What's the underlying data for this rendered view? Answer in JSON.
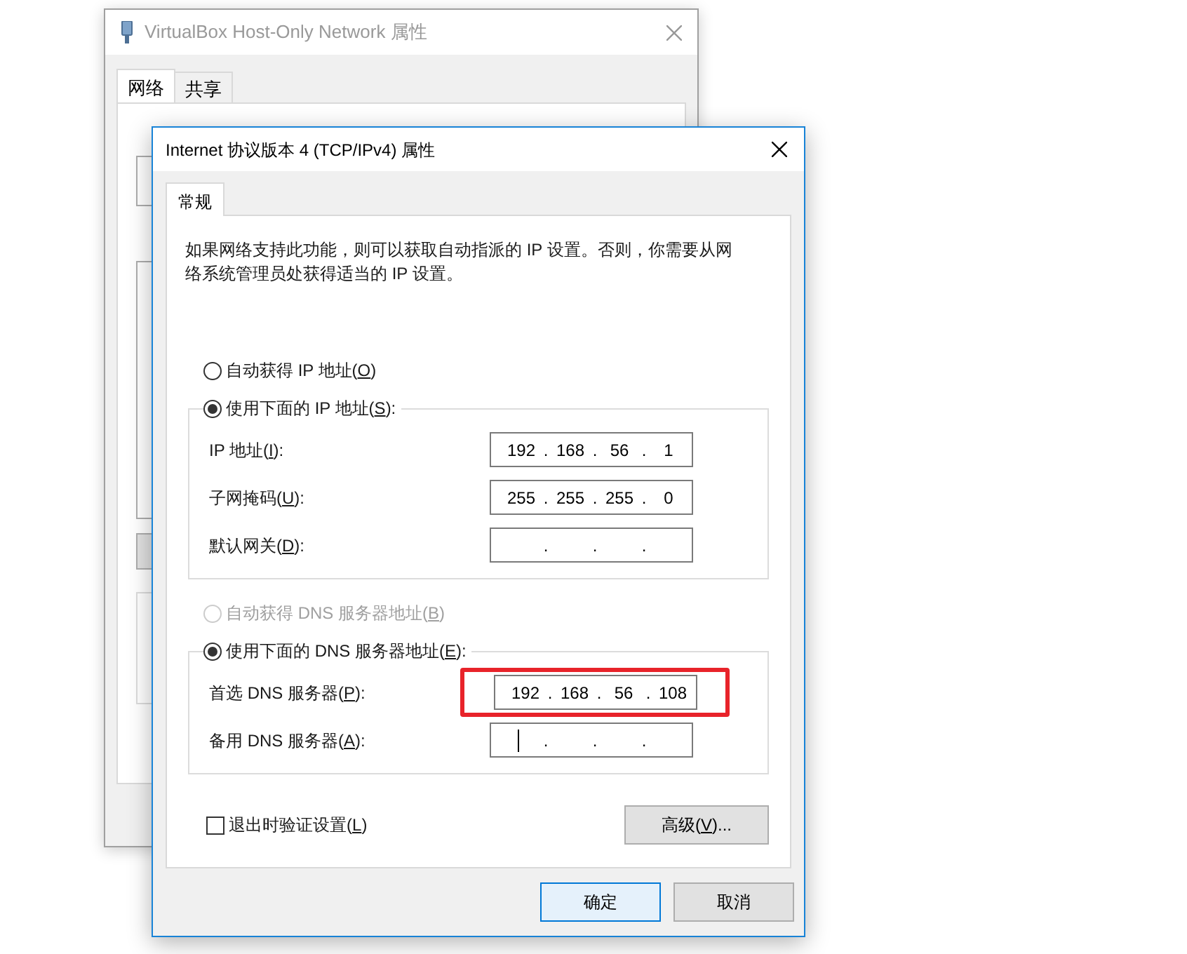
{
  "back_window": {
    "title": "VirtualBox Host-Only Network 属性",
    "tabs": [
      {
        "label": "网络",
        "selected": true
      },
      {
        "label": "共享",
        "selected": false
      }
    ]
  },
  "dialog": {
    "title": "Internet 协议版本 4 (TCP/IPv4) 属性",
    "tabs": [
      {
        "label": "常规",
        "selected": true
      }
    ],
    "description": "如果网络支持此功能，则可以获取自动指派的 IP 设置。否则，你需要从网络系统管理员处获得适当的 IP 设置。",
    "separator": ".",
    "ip_groups": [
      {
        "auto": {
          "label": "自动获得 IP 地址(O)",
          "selected": false,
          "disabled": false
        },
        "manual": {
          "label": "使用下面的 IP 地址(S):",
          "selected": true,
          "disabled": false
        },
        "fields": [
          {
            "label": "IP 地址(I):",
            "octets": [
              "192",
              "168",
              "56",
              "1"
            ],
            "focused": false,
            "highlighted": false
          },
          {
            "label": "子网掩码(U):",
            "octets": [
              "255",
              "255",
              "255",
              "0"
            ],
            "focused": false,
            "highlighted": false
          },
          {
            "label": "默认网关(D):",
            "focused": false,
            "highlighted": false
          }
        ]
      },
      {
        "auto": {
          "label": "自动获得 DNS 服务器地址(B)",
          "selected": false,
          "disabled": true
        },
        "manual": {
          "label": "使用下面的 DNS 服务器地址(E):",
          "selected": true,
          "disabled": false
        },
        "fields": [
          {
            "label": "首选 DNS 服务器(P):",
            "octets": [
              "192",
              "168",
              "56",
              "108"
            ],
            "focused": false,
            "highlighted": true
          },
          {
            "label": "备用 DNS 服务器(A):",
            "focused": true,
            "highlighted": false
          }
        ]
      }
    ],
    "validate": {
      "label": "退出时验证设置(L)",
      "checked": false
    },
    "advanced_button": "高级(V)...",
    "buttons": [
      {
        "label": "确定",
        "default": true
      },
      {
        "label": "取消",
        "default": false
      }
    ]
  }
}
